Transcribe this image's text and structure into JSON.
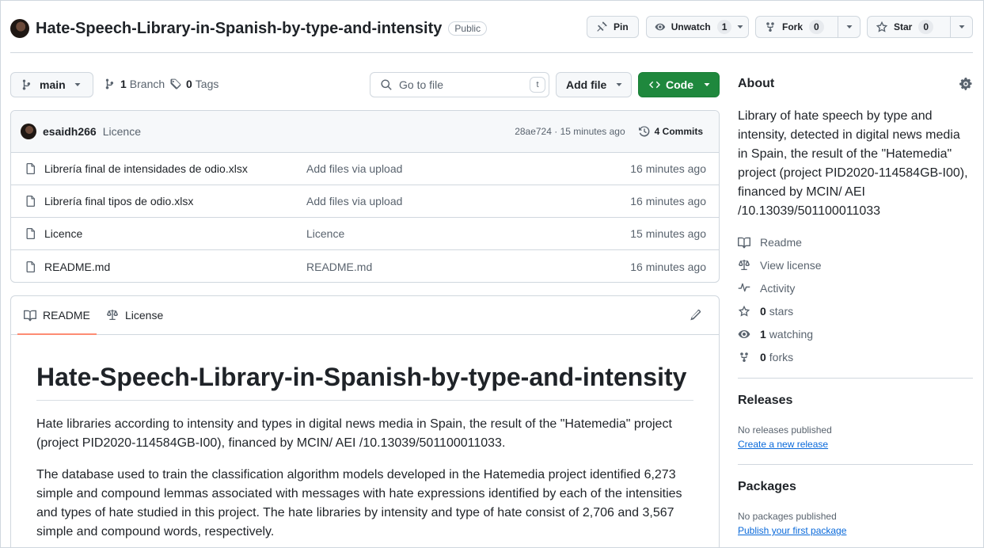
{
  "repo": {
    "name": "Hate-Speech-Library-in-Spanish-by-type-and-intensity",
    "visibility": "Public"
  },
  "actions": {
    "pin_label": "Pin",
    "unwatch_label": "Unwatch",
    "unwatch_count": "1",
    "fork_label": "Fork",
    "fork_count": "0",
    "star_label": "Star",
    "star_count": "0"
  },
  "branch_bar": {
    "current_branch": "main",
    "branches_count": "1",
    "branches_label": "Branch",
    "tags_count": "0",
    "tags_label": "Tags",
    "go_to_file_placeholder": "Go to file",
    "go_to_file_shortcut": "t",
    "add_file_label": "Add file",
    "code_label": "Code"
  },
  "commit": {
    "author": "esaidh266",
    "message": "Licence",
    "hash_time": "28ae724 · 15 minutes ago",
    "commits_count": "4",
    "commits_label": "Commits"
  },
  "files": [
    {
      "name": "Librería final de intensidades de odio.xlsx",
      "message": "Add files via upload",
      "time": "16 minutes ago"
    },
    {
      "name": "Librería final tipos de odio.xlsx",
      "message": "Add files via upload",
      "time": "16 minutes ago"
    },
    {
      "name": "Licence",
      "message": "Licence",
      "time": "15 minutes ago"
    },
    {
      "name": "README.md",
      "message": "README.md",
      "time": "16 minutes ago"
    }
  ],
  "readme": {
    "tab_readme": "README",
    "tab_license": "License",
    "heading": "Hate-Speech-Library-in-Spanish-by-type-and-intensity",
    "paragraph1": "Hate libraries according to intensity and types in digital news media in Spain, the result of the \"Hatemedia\" project (project PID2020-114584GB-I00), financed by MCIN/ AEI /10.13039/501100011033.",
    "paragraph2": "The database used to train the classification algorithm models developed in the Hatemedia project identified 6,273 simple and compound lemmas associated with messages with hate expressions identified by each of the intensities and types of hate studied in this project. The hate libraries by intensity and type of hate consist of 2,706 and 3,567 simple and compound words, respectively."
  },
  "about": {
    "title": "About",
    "description": "Library of hate speech by type and intensity, detected in digital news media in Spain, the result of the \"Hatemedia\" project (project PID2020-114584GB-I00), financed by MCIN/ AEI /10.13039/501100011033",
    "readme_link": "Readme",
    "license_link": "View license",
    "activity_link": "Activity",
    "stars_count": "0",
    "stars_label": "stars",
    "watching_count": "1",
    "watching_label": "watching",
    "forks_count": "0",
    "forks_label": "forks"
  },
  "releases": {
    "title": "Releases",
    "empty_text": "No releases published",
    "create_link": "Create a new release"
  },
  "packages": {
    "title": "Packages",
    "empty_text": "No packages published",
    "publish_link": "Publish your first package"
  },
  "colors": {
    "code_button": "#1f883d",
    "link": "#0969da",
    "active_tab_underline": "#fd8c73"
  }
}
